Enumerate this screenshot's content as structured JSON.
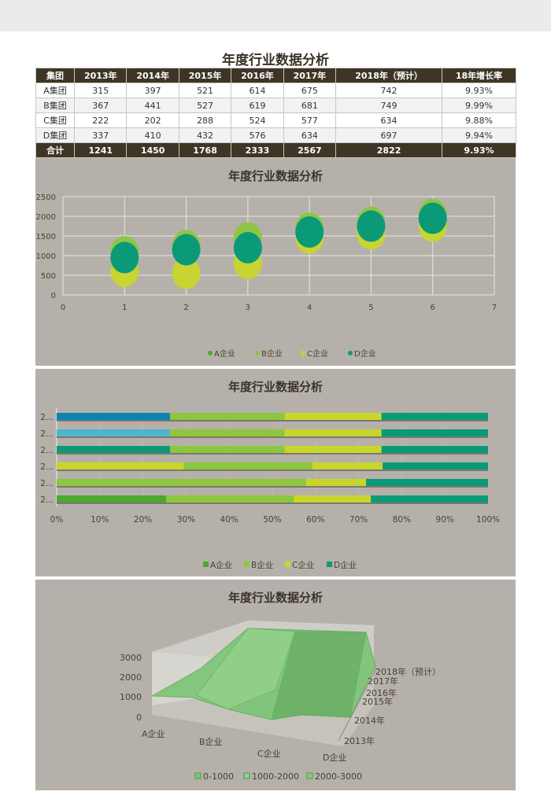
{
  "title": "年度行业数据分析",
  "table": {
    "headers": [
      "集团",
      "2013年",
      "2014年",
      "2015年",
      "2016年",
      "2017年",
      "2018年（预计）",
      "18年增长率"
    ],
    "rows": [
      [
        "A集团",
        "315",
        "397",
        "521",
        "614",
        "675",
        "742",
        "9.93%"
      ],
      [
        "B集团",
        "367",
        "441",
        "527",
        "619",
        "681",
        "749",
        "9.99%"
      ],
      [
        "C集团",
        "222",
        "202",
        "288",
        "524",
        "577",
        "634",
        "9.88%"
      ],
      [
        "D集团",
        "337",
        "410",
        "432",
        "576",
        "634",
        "697",
        "9.94%"
      ]
    ],
    "total": [
      "合计",
      "1241",
      "1450",
      "1768",
      "2333",
      "2567",
      "2822",
      "9.93%"
    ]
  },
  "chart_data": [
    {
      "type": "scatter",
      "subtype": "bubble",
      "title": "年度行业数据分析",
      "x_ticks": [
        "0",
        "1",
        "2",
        "3",
        "4",
        "5",
        "6",
        "7"
      ],
      "xlim": [
        0,
        7
      ],
      "y_ticks": [
        "0",
        "500",
        "1000",
        "1500",
        "2000",
        "2500"
      ],
      "ylim": [
        0,
        2500
      ],
      "grid": true,
      "legend": "bottom",
      "x": [
        1,
        2,
        3,
        4,
        5,
        6
      ],
      "series": [
        {
          "name": "A企业",
          "color": "#4ea72e",
          "values": []
        },
        {
          "name": "B企业",
          "color": "#8dc63f",
          "values": [
            1100,
            1250,
            1450,
            1700,
            1850,
            2050
          ]
        },
        {
          "name": "C企业",
          "color": "#c8d62b",
          "values": [
            600,
            550,
            800,
            1450,
            1550,
            1750
          ]
        },
        {
          "name": "D企业",
          "color": "#0a9a78",
          "values": [
            950,
            1150,
            1200,
            1600,
            1750,
            1950
          ]
        }
      ]
    },
    {
      "type": "bar",
      "subtype": "100%-stacked-horizontal",
      "title": "年度行业数据分析",
      "categories": [
        "2...",
        "2...",
        "2...",
        "2...",
        "2...",
        "2..."
      ],
      "x_ticks": [
        "0%",
        "10%",
        "20%",
        "30%",
        "40%",
        "50%",
        "60%",
        "70%",
        "80%",
        "90%",
        "100%"
      ],
      "legend": "bottom",
      "grid": true,
      "series": [
        {
          "name": "A企业",
          "color": "#4ea72e",
          "point_colors": [
            "#0a84b4",
            "#4bb8cc",
            "#0a9a78",
            "#c8d62b",
            "#8dc63f",
            "#4ea72e"
          ],
          "values": [
            742,
            675,
            614,
            521,
            397,
            315
          ]
        },
        {
          "name": "B企业",
          "color": "#8dc63f",
          "values": [
            749,
            681,
            619,
            527,
            441,
            367
          ]
        },
        {
          "name": "C企业",
          "color": "#c8d62b",
          "values": [
            634,
            577,
            524,
            288,
            202,
            222
          ]
        },
        {
          "name": "D企业",
          "color": "#0a9a78",
          "values": [
            697,
            634,
            576,
            432,
            410,
            337
          ]
        }
      ]
    },
    {
      "type": "area",
      "subtype": "3d-surface",
      "title": "年度行业数据分析",
      "categories": [
        "A企业",
        "B企业",
        "C企业",
        "D企业"
      ],
      "depth_categories": [
        "2013年",
        "2014年",
        "2015年",
        "2016年",
        "2017年",
        "2018年（预计）"
      ],
      "z_ticks": [
        "0",
        "1000",
        "2000",
        "3000"
      ],
      "zlim": [
        0,
        3000
      ],
      "legend": "bottom",
      "legend_entries": [
        {
          "name": "0-1000",
          "color": "#7cc576"
        },
        {
          "name": "1000-2000",
          "color": "#94d18b"
        },
        {
          "name": "2000-3000",
          "color": "#86c97d"
        }
      ]
    }
  ]
}
